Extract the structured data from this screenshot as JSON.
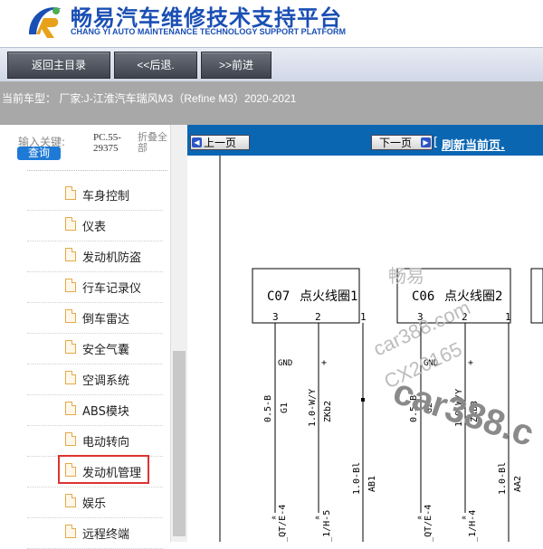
{
  "header": {
    "brand_cn": "畅易汽车维修技术支持平台",
    "brand_en": "CHANG YI AUTO MAINTENANCE TECHNOLOGY SUPPORT PLATFORM"
  },
  "toolbar": {
    "home_label": "返回主目录",
    "back_label": "<<后退.",
    "forward_label": ">>前进"
  },
  "vehicle": {
    "text": "当前车型：  厂家:J-江淮汽车瑞风M3（Refine M3）2020-2021"
  },
  "sidebar": {
    "search_label": "输入关键:",
    "search_button": "查询",
    "pc_code": "PC.55-29375",
    "collapse_label": "折叠全部",
    "items": [
      {
        "label": "车身控制"
      },
      {
        "label": "仪表"
      },
      {
        "label": "发动机防盗"
      },
      {
        "label": "行车记录仪"
      },
      {
        "label": "倒车雷达"
      },
      {
        "label": "安全气囊"
      },
      {
        "label": "空调系统"
      },
      {
        "label": "ABS模块"
      },
      {
        "label": "电动转向"
      },
      {
        "label": "发动机管理"
      },
      {
        "label": "娱乐"
      },
      {
        "label": "远程终端"
      }
    ],
    "selected_item": "发动机管理"
  },
  "main": {
    "prev_page": "上一页",
    "next_page": "下一页",
    "refresh": "刷新当前页.",
    "refresh_open": "["
  },
  "diagram": {
    "connector1": {
      "code": "C07",
      "name": "点火线圈1"
    },
    "connector2": {
      "code": "C06",
      "name": "点火线圈2"
    },
    "pins1": [
      "3",
      "2",
      "1"
    ],
    "pins2": [
      "3",
      "2",
      "1"
    ],
    "signals": [
      "GND",
      "+",
      "GND",
      "+"
    ],
    "wires": {
      "w1": "0.5-B",
      "w1b": "G1",
      "w2": "1.0-W/Y",
      "w2b": "ZKb2",
      "w3": "1.0-Bl",
      "w3b": "AB1",
      "w4": "0.5-B",
      "w4b": "G2",
      "w5": "1.0-W/Y",
      "w5b": "ZKb3",
      "w6": "1.0-Bl",
      "w6b": "AA2"
    },
    "ends": {
      "e1": "0-GND_QT/E-4",
      "e2": "1-UEC_1/H-5",
      "e3": "0-GND_QT/E-4",
      "e4": "1-UEC_1/H-4"
    },
    "watermarks": [
      "畅易",
      "car388.com",
      "CX20165",
      "car388.c"
    ]
  },
  "colors": {
    "brand_blue": "#1a4fb4",
    "nav_blue": "#0b66b2",
    "highlight_red": "#dd3333",
    "vehicle_bar_gray": "#a8a8a8"
  }
}
